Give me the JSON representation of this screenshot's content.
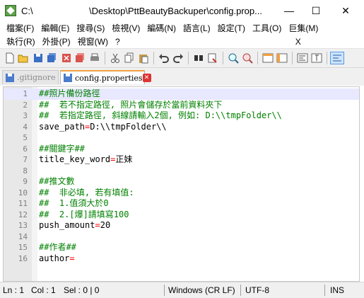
{
  "window": {
    "title": "C:\\",
    "path": "\\Desktop\\PttBeautyBackuper\\config.prop...",
    "minimize": "—",
    "maximize": "☐",
    "close": "✕"
  },
  "menu": {
    "row1": [
      "檔案(F)",
      "編輯(E)",
      "搜尋(S)",
      "檢視(V)",
      "編碼(N)",
      "語言(L)",
      "設定(T)",
      "工具(O)",
      "巨集(M)"
    ],
    "row2": [
      "執行(R)",
      "外掛(P)",
      "視窗(W)",
      "?",
      "X"
    ]
  },
  "tabs": [
    {
      "label": ".gitignore",
      "active": false
    },
    {
      "label": "config.properties",
      "active": true
    }
  ],
  "editor": {
    "lines": [
      {
        "n": "1",
        "text": "##照片備份路徑",
        "type": "comment"
      },
      {
        "n": "2",
        "text": "##  若不指定路徑, 照片會儲存於當前資料夾下",
        "type": "comment"
      },
      {
        "n": "3",
        "text": "##  若指定路徑, 斜線請輸入2個, 例如: D:\\\\tmpFolder\\\\",
        "type": "comment"
      },
      {
        "n": "4",
        "key": "save_path",
        "value": "D:\\\\tmpFolder\\\\",
        "type": "kv"
      },
      {
        "n": "5",
        "text": "",
        "type": "blank"
      },
      {
        "n": "6",
        "text": "##關鍵字##",
        "type": "comment"
      },
      {
        "n": "7",
        "key": "title_key_word",
        "value": "正妹",
        "type": "kv"
      },
      {
        "n": "8",
        "text": "",
        "type": "blank"
      },
      {
        "n": "9",
        "text": "##推文數",
        "type": "comment"
      },
      {
        "n": "10",
        "text": "##  非必填, 若有填值:",
        "type": "comment"
      },
      {
        "n": "11",
        "text": "##  1.值須大於0",
        "type": "comment"
      },
      {
        "n": "12",
        "text": "##  2.[爆]請填寫100",
        "type": "comment"
      },
      {
        "n": "13",
        "key": "push_amount",
        "value": "20",
        "type": "kv"
      },
      {
        "n": "14",
        "text": "",
        "type": "blank"
      },
      {
        "n": "15",
        "text": "##作者##",
        "type": "comment"
      },
      {
        "n": "16",
        "key": "author",
        "value": "",
        "type": "kv"
      }
    ]
  },
  "status": {
    "ln": "Ln : 1",
    "col": "Col : 1",
    "sel": "Sel : 0 | 0",
    "eol": "Windows (CR LF)",
    "encoding": "UTF-8",
    "mode": "INS"
  },
  "colors": {
    "comment": "#008000",
    "operator": "#ff0000",
    "current_line": "#e8e8ff",
    "active_tab_accent": "#f0a040"
  },
  "toolbar_icons": [
    "new-file-icon",
    "open-file-icon",
    "save-icon",
    "save-all-icon",
    "close-icon",
    "close-all-icon",
    "print-icon",
    "cut-icon",
    "copy-icon",
    "paste-icon",
    "undo-icon",
    "redo-icon",
    "find-icon",
    "replace-icon",
    "zoom-in-icon",
    "zoom-out-icon",
    "sync-v-icon",
    "sync-h-icon",
    "word-wrap-icon"
  ]
}
